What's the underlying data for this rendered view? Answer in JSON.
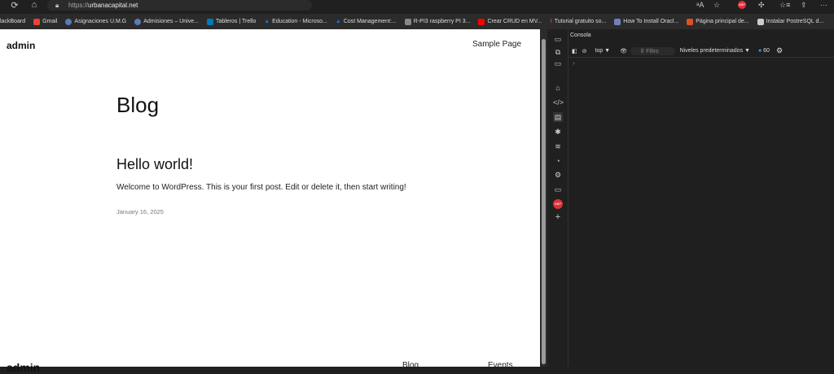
{
  "browser": {
    "url_prefix": "https://",
    "url_domain": "urbanacapital.net",
    "bookmarks": [
      {
        "label": "lackBoard",
        "color": ""
      },
      {
        "label": "Gmail",
        "color": "#ea4335"
      },
      {
        "label": "Asignaciones U.M.G",
        "color": "#5a7bb5"
      },
      {
        "label": "Admisiones – Unive...",
        "color": "#5a7bb5"
      },
      {
        "label": "Tableros | Trello",
        "color": "#0079bf"
      },
      {
        "label": "Education - Microso...",
        "color": "#1e73c8"
      },
      {
        "label": "Cost Management:...",
        "color": "#1e73c8"
      },
      {
        "label": "R-PI3 raspberry PI 3...",
        "color": "#888888"
      },
      {
        "label": "Crear CRUD en MV...",
        "color": "#ff0000"
      },
      {
        "label": "Tutorial gratuito so...",
        "color": "#e34c4c"
      },
      {
        "label": "How To Install Oracl...",
        "color": "#7080c0"
      },
      {
        "label": "Página principal de...",
        "color": "#e05020"
      },
      {
        "label": "Instalar PostreSQL d...",
        "color": "#cccccc"
      }
    ]
  },
  "page": {
    "site_title": "admin",
    "nav_sample": "Sample Page",
    "heading": "Blog",
    "post_title": "Hello world!",
    "post_body": "Welcome to WordPress. This is your first post. Edit or delete it, then start writing!",
    "post_date": "January 16, 2025",
    "footer_title": "admin",
    "footer_links": [
      "Blog",
      "Events"
    ]
  },
  "devtools": {
    "tab": "Consola",
    "context": "top",
    "filter_placeholder": "Filtro",
    "levels": "Niveles predeterminados",
    "issues_count": "60",
    "prompt": "›",
    "abp": "ABP"
  }
}
